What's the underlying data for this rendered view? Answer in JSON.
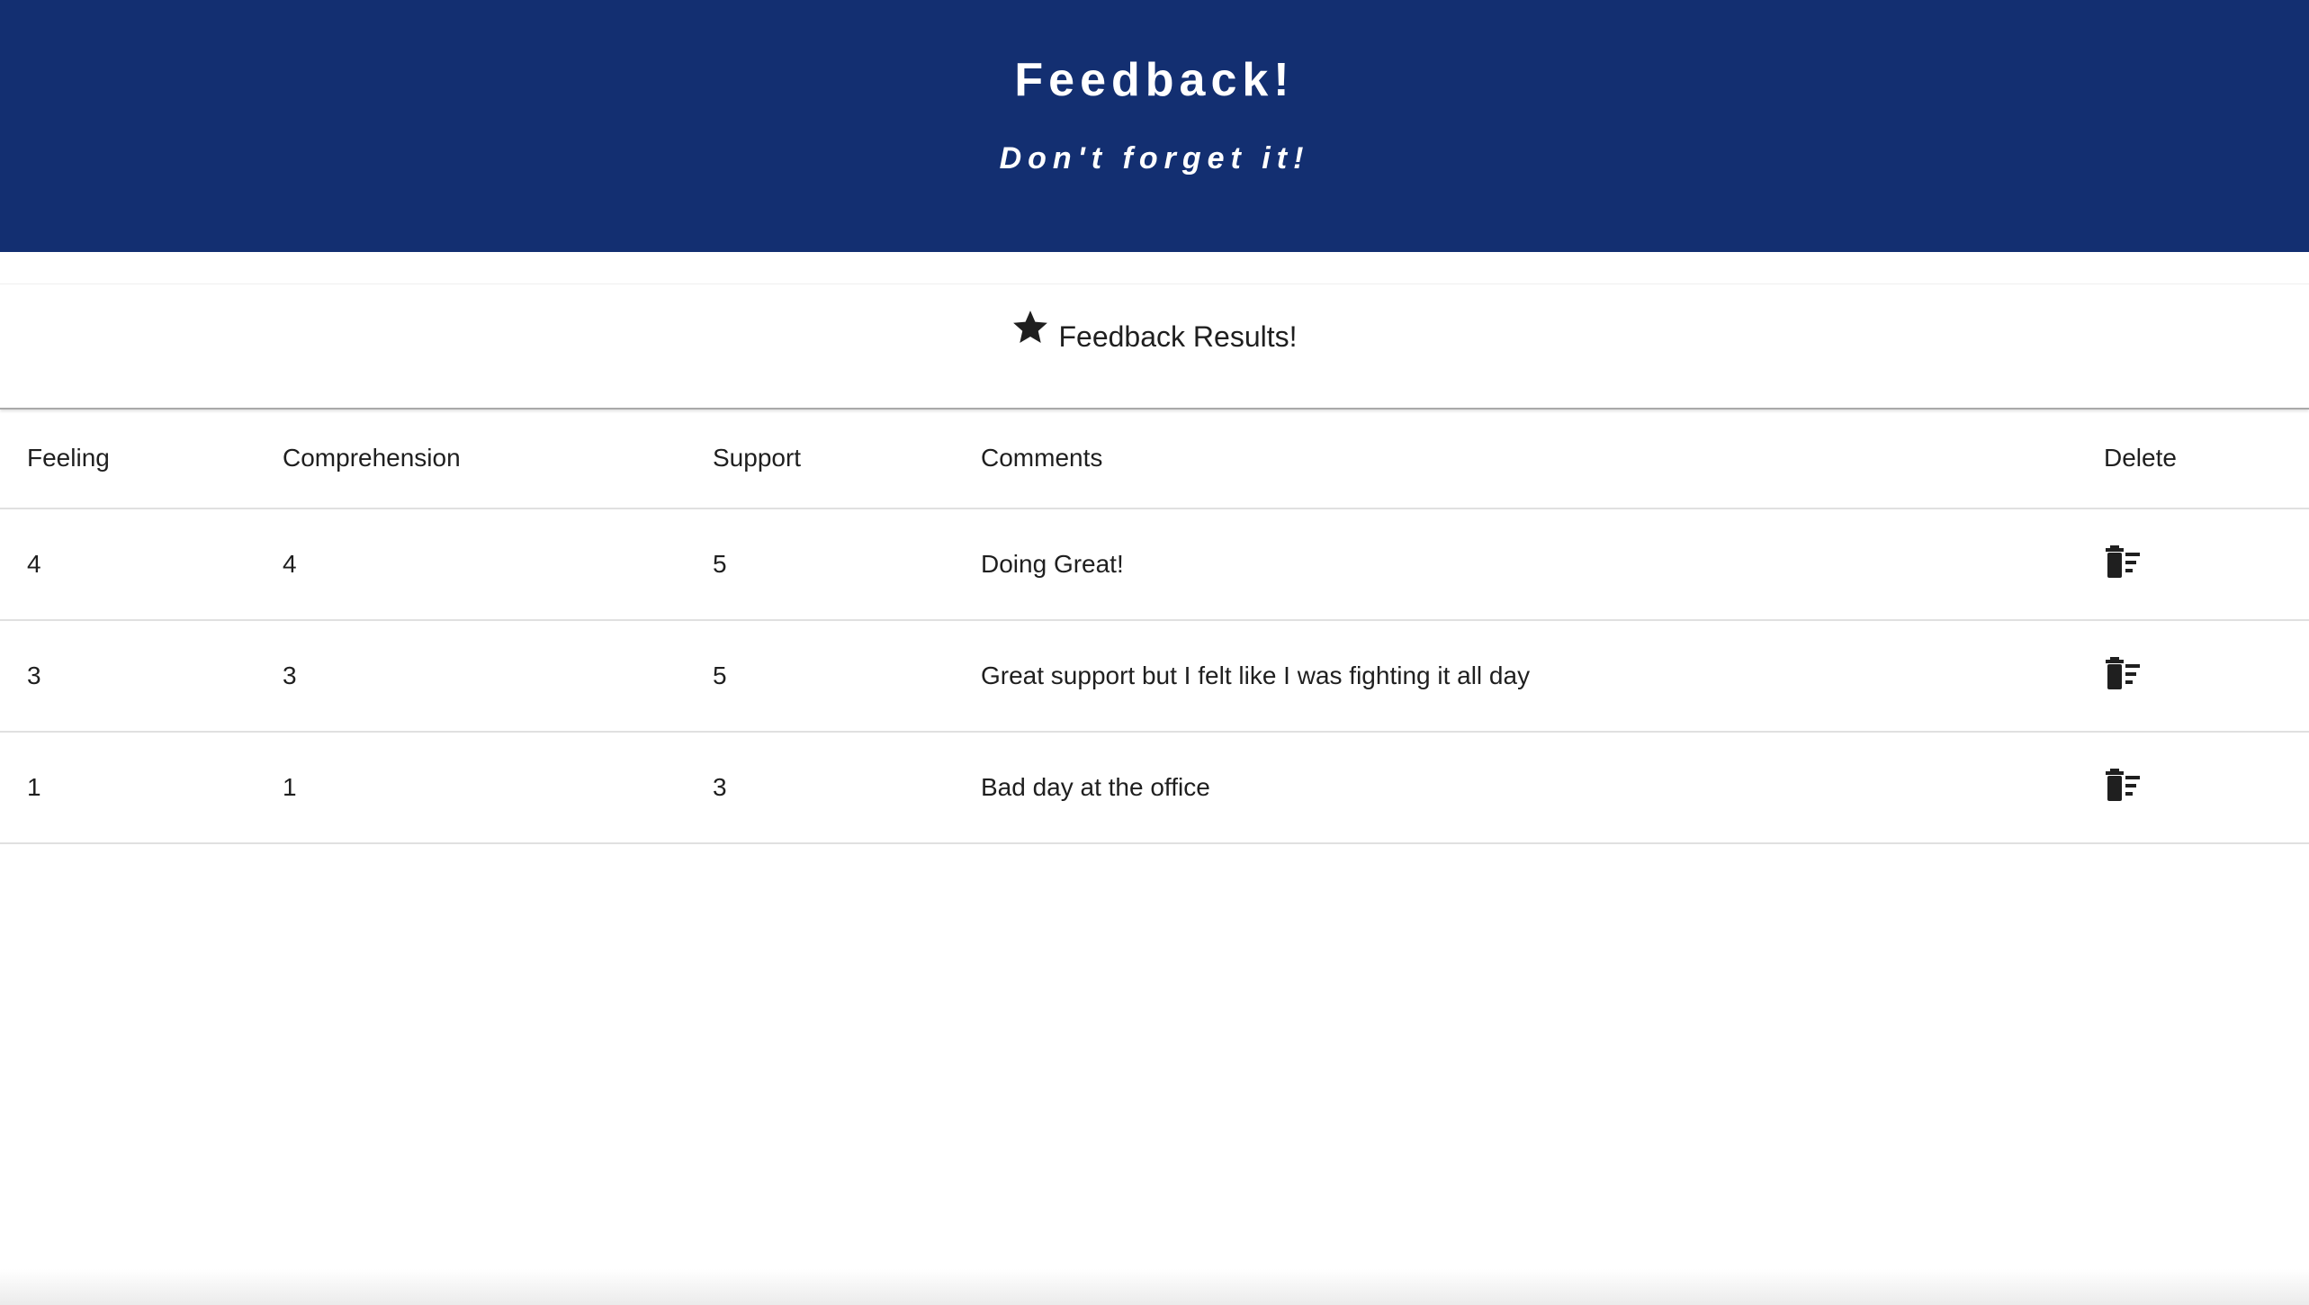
{
  "header": {
    "title": "Feedback!",
    "subtitle": "Don't forget it!",
    "background_color": "#132f71",
    "text_color": "#ffffff"
  },
  "results_card": {
    "icon": "star-icon",
    "title": "Feedback Results!"
  },
  "table": {
    "columns": [
      "Feeling",
      "Comprehension",
      "Support",
      "Comments",
      "Delete"
    ],
    "rows": [
      {
        "feeling": "4",
        "comprehension": "4",
        "support": "5",
        "comments": "Doing Great!",
        "delete_icon": "trash-list-icon"
      },
      {
        "feeling": "3",
        "comprehension": "3",
        "support": "5",
        "comments": "Great support but I felt like I was fighting it all day",
        "delete_icon": "trash-list-icon"
      },
      {
        "feeling": "1",
        "comprehension": "1",
        "support": "3",
        "comments": "Bad day at the office",
        "delete_icon": "trash-list-icon"
      }
    ]
  }
}
